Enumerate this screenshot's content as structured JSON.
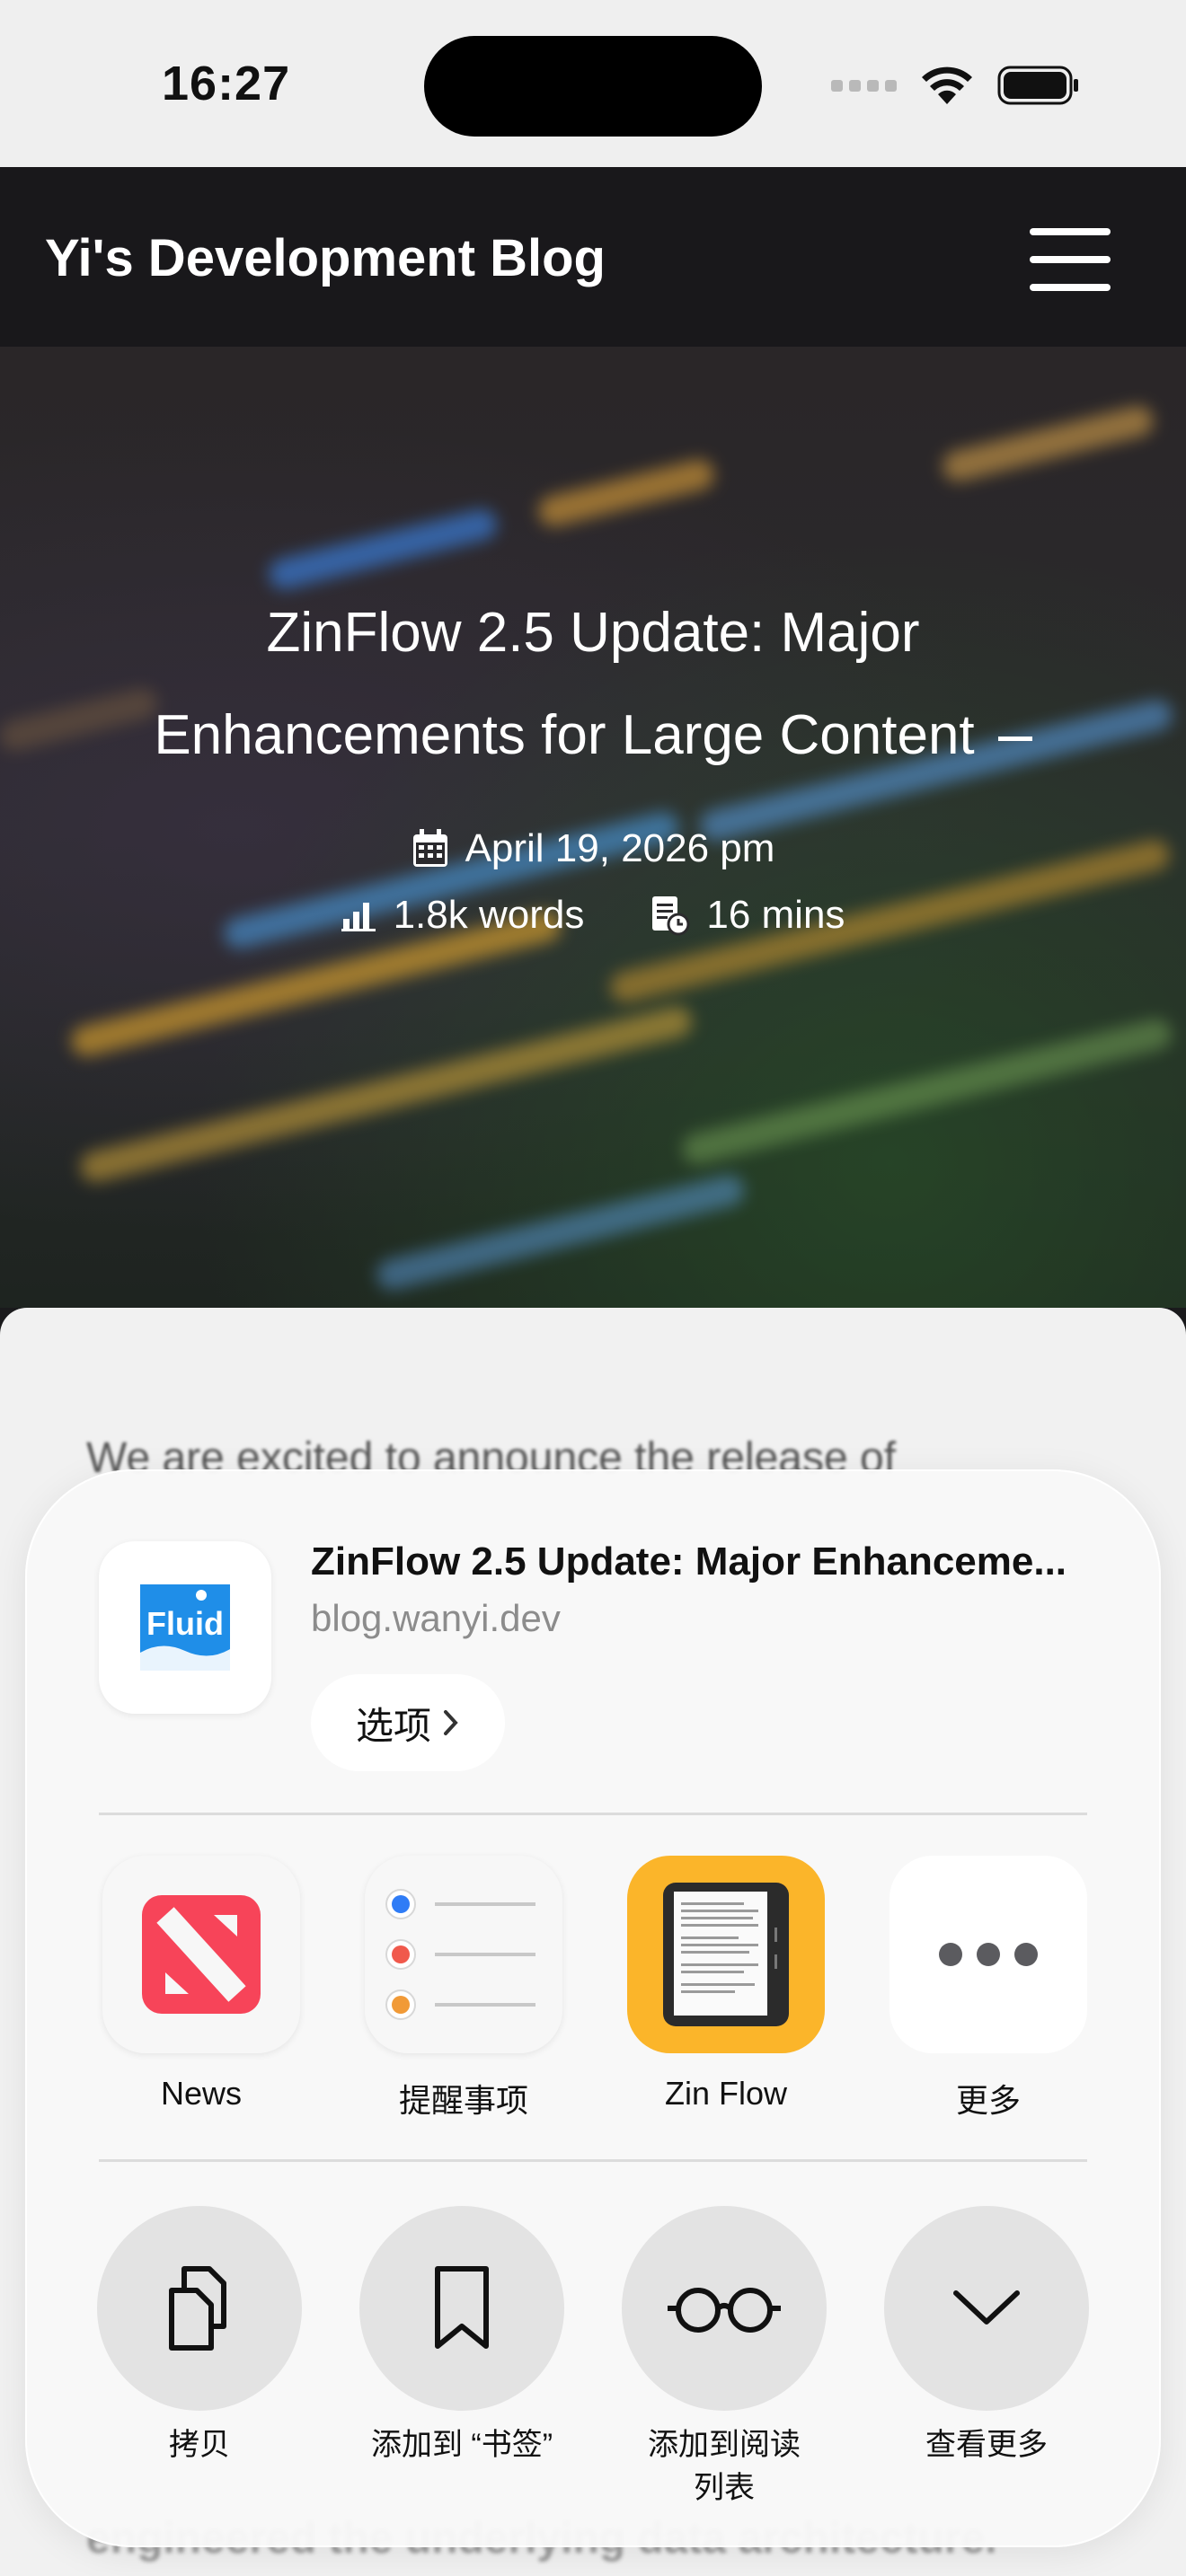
{
  "status_bar": {
    "time": "16:27"
  },
  "navbar": {
    "blog_title": "Yi's Development Blog"
  },
  "hero": {
    "title_line1": "ZinFlow 2.5 Update: Major",
    "title_line2": "Enhancements for Large Content",
    "date": "April 19, 2026 pm",
    "words": "1.8k words",
    "read_time": "16 mins"
  },
  "article": {
    "first_line": "We are excited to announce the release of",
    "footer_line": "engineered the underlying data architecture."
  },
  "share_sheet": {
    "preview": {
      "title": "ZinFlow 2.5 Update: Major Enhanceme...",
      "domain": "blog.wanyi.dev",
      "options_label": "选项",
      "icon_text": "Fluid"
    },
    "apps": [
      {
        "label": "News",
        "icon": "news-icon"
      },
      {
        "label": "提醒事项",
        "icon": "reminders-icon"
      },
      {
        "label": "Zin Flow",
        "icon": "zinflow-icon"
      },
      {
        "label": "更多",
        "icon": "more-icon"
      }
    ],
    "actions": [
      {
        "label": "拷贝",
        "icon": "copy-icon"
      },
      {
        "label": "添加到 “书签”",
        "icon": "bookmark-icon"
      },
      {
        "label_line1": "添加到阅读",
        "label_line2": "列表",
        "icon": "glasses-icon"
      },
      {
        "label": "查看更多",
        "icon": "chevron-down-icon"
      }
    ]
  },
  "colors": {
    "news_red": "#f74459",
    "zinflow_yellow": "#fbb52a",
    "fluid_blue": "#1f8ee8"
  }
}
